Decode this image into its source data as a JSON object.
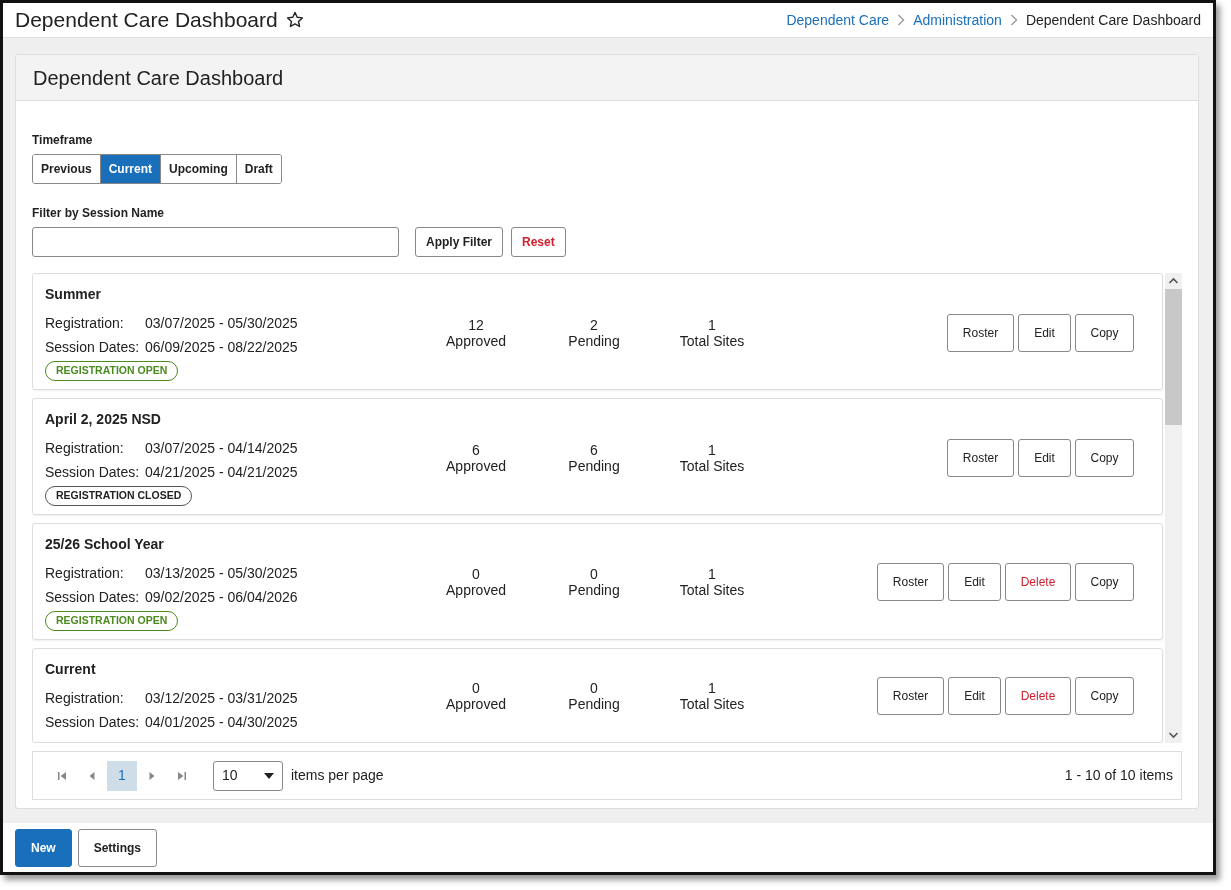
{
  "page_title": "Dependent Care Dashboard",
  "breadcrumbs": [
    {
      "label": "Dependent Care",
      "link": true
    },
    {
      "label": "Administration",
      "link": true
    },
    {
      "label": "Dependent Care Dashboard",
      "link": false
    }
  ],
  "panel_title": "Dependent Care Dashboard",
  "timeframe": {
    "label": "Timeframe",
    "options": [
      {
        "label": "Previous",
        "selected": false
      },
      {
        "label": "Current",
        "selected": true
      },
      {
        "label": "Upcoming",
        "selected": false
      },
      {
        "label": "Draft",
        "selected": false
      }
    ]
  },
  "filter": {
    "label": "Filter by Session Name",
    "apply_button": "Apply Filter",
    "reset_button": "Reset"
  },
  "sessions": [
    {
      "name": "Summer",
      "registration_label": "Registration:",
      "registration": "03/07/2025 - 05/30/2025",
      "session_label": "Session Dates:",
      "session_dates": "06/09/2025 - 08/22/2025",
      "status": {
        "text": "REGISTRATION OPEN",
        "kind": "open"
      },
      "stats": [
        {
          "value": "12",
          "label": "Approved"
        },
        {
          "value": "2",
          "label": "Pending"
        },
        {
          "value": "1",
          "label": "Total Sites"
        }
      ],
      "actions": [
        {
          "label": "Roster",
          "kind": "default"
        },
        {
          "label": "Edit",
          "kind": "default"
        },
        {
          "label": "Copy",
          "kind": "default"
        }
      ]
    },
    {
      "name": "April 2, 2025 NSD",
      "registration_label": "Registration:",
      "registration": "03/07/2025 - 04/14/2025",
      "session_label": "Session Dates:",
      "session_dates": "04/21/2025 - 04/21/2025",
      "status": {
        "text": "REGISTRATION CLOSED",
        "kind": "closed"
      },
      "stats": [
        {
          "value": "6",
          "label": "Approved"
        },
        {
          "value": "6",
          "label": "Pending"
        },
        {
          "value": "1",
          "label": "Total Sites"
        }
      ],
      "actions": [
        {
          "label": "Roster",
          "kind": "default"
        },
        {
          "label": "Edit",
          "kind": "default"
        },
        {
          "label": "Copy",
          "kind": "default"
        }
      ]
    },
    {
      "name": "25/26 School Year",
      "registration_label": "Registration:",
      "registration": "03/13/2025 - 05/30/2025",
      "session_label": "Session Dates:",
      "session_dates": "09/02/2025 - 06/04/2026",
      "status": {
        "text": "REGISTRATION OPEN",
        "kind": "open"
      },
      "stats": [
        {
          "value": "0",
          "label": "Approved"
        },
        {
          "value": "0",
          "label": "Pending"
        },
        {
          "value": "1",
          "label": "Total Sites"
        }
      ],
      "actions": [
        {
          "label": "Roster",
          "kind": "default"
        },
        {
          "label": "Edit",
          "kind": "default"
        },
        {
          "label": "Delete",
          "kind": "danger"
        },
        {
          "label": "Copy",
          "kind": "default"
        }
      ]
    },
    {
      "name": "Current",
      "registration_label": "Registration:",
      "registration": "03/12/2025 - 03/31/2025",
      "session_label": "Session Dates:",
      "session_dates": "04/01/2025 - 04/30/2025",
      "stats": [
        {
          "value": "0",
          "label": "Approved"
        },
        {
          "value": "0",
          "label": "Pending"
        },
        {
          "value": "1",
          "label": "Total Sites"
        }
      ],
      "actions": [
        {
          "label": "Roster",
          "kind": "default"
        },
        {
          "label": "Edit",
          "kind": "default"
        },
        {
          "label": "Delete",
          "kind": "danger"
        },
        {
          "label": "Copy",
          "kind": "default"
        }
      ]
    }
  ],
  "pager": {
    "page": "1",
    "per_page": "10",
    "per_page_label": "items per page",
    "summary": "1 - 10 of 10 items"
  },
  "footer_buttons": [
    {
      "label": "New",
      "kind": "primary"
    },
    {
      "label": "Settings",
      "kind": "default"
    }
  ]
}
